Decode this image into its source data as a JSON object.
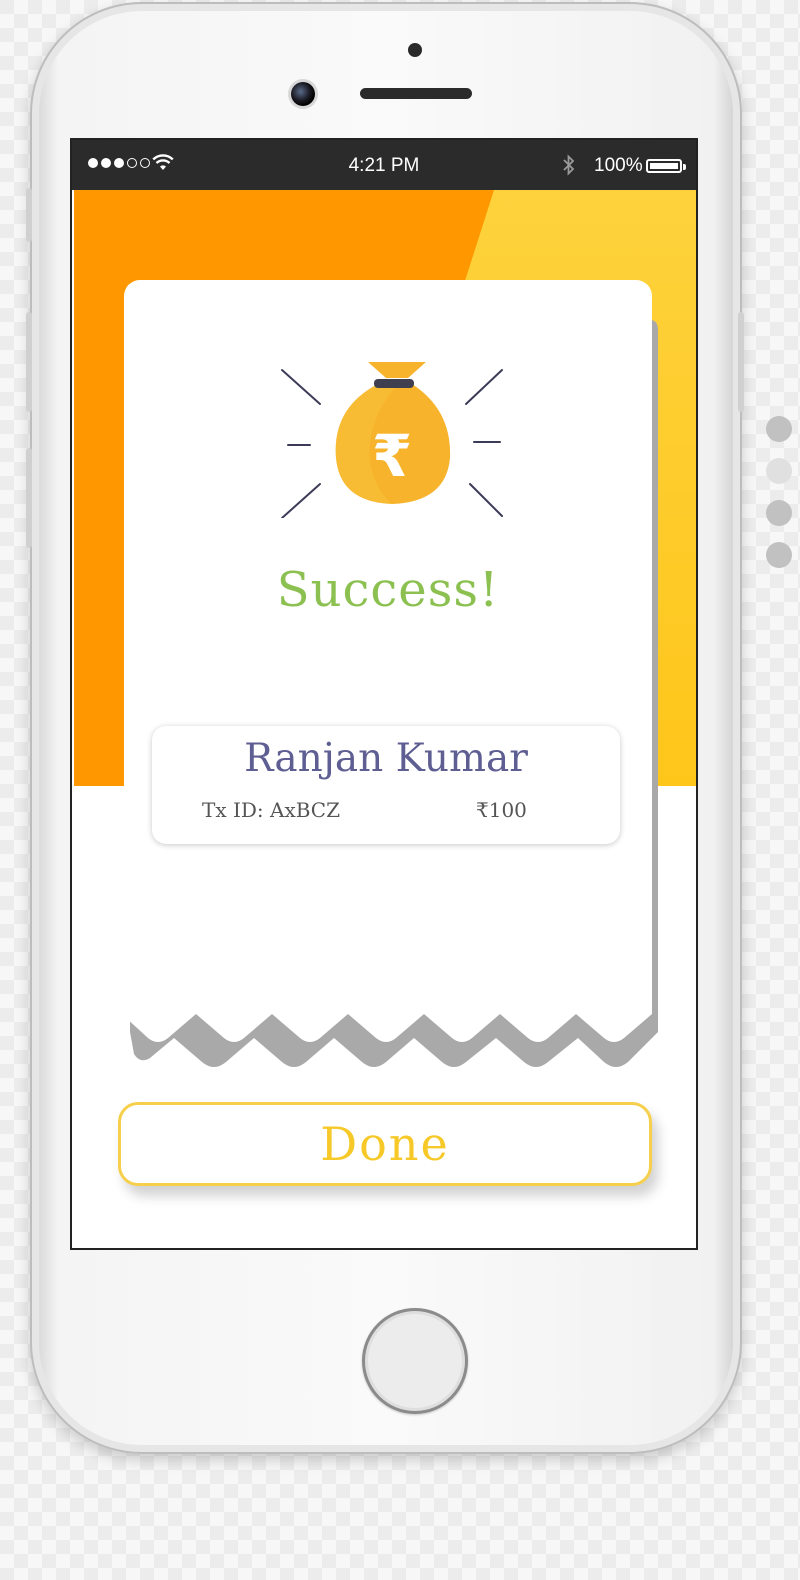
{
  "status_bar": {
    "time": "4:21 PM",
    "battery_text": "100%",
    "signal_icon": "signal-dots-icon",
    "wifi_icon": "wifi-icon",
    "bluetooth_icon": "bluetooth-icon",
    "battery_icon": "battery-icon"
  },
  "result": {
    "title": "Success!",
    "icon": "money-bag-rupee-icon",
    "recipient_name": "Ranjan Kumar",
    "tx_id_text": "Tx ID: AxBCZ",
    "amount_text": "₹100"
  },
  "actions": {
    "done_label": "Done"
  },
  "pager": {
    "count": 4,
    "active_index": 1
  },
  "colors": {
    "accent_orange": "#ff9800",
    "accent_yellow": "#fdcc31",
    "success_green": "#8cc152",
    "name_purple": "#5e5e93",
    "done_yellow": "#f6c928"
  }
}
